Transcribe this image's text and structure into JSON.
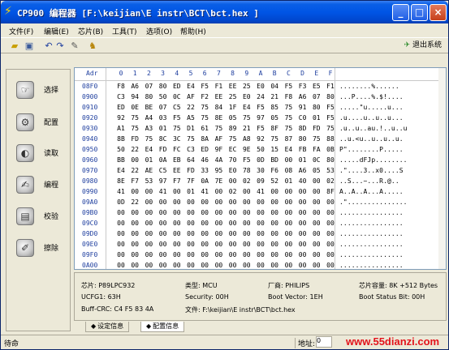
{
  "window": {
    "title": "CP900 编程器  [F:\\keijian\\E instr\\BCT\\bct.hex ]",
    "minimize": "_",
    "maximize": "□",
    "close": "×"
  },
  "menu": [
    "文件(F)",
    "编辑(E)",
    "芯片(B)",
    "工具(T)",
    "选项(O)",
    "帮助(H)"
  ],
  "toolbar": {
    "icons": [
      "open-folder-icon",
      "save-icon",
      "undo-icon",
      "redo-icon",
      "edit-icon",
      "find-icon"
    ],
    "exit_label": "退出系统"
  },
  "sidebar": [
    "选择",
    "配置",
    "读取",
    "编程",
    "校验",
    "擦除"
  ],
  "hex": {
    "addr_header": "Adr",
    "cols": [
      "0",
      "1",
      "2",
      "3",
      "4",
      "5",
      "6",
      "7",
      "8",
      "9",
      "A",
      "B",
      "C",
      "D",
      "E",
      "F"
    ],
    "rows": [
      {
        "addr": "08F0",
        "bytes": [
          "F8",
          "A6",
          "07",
          "80",
          "ED",
          "E4",
          "F5",
          "F1",
          "EE",
          "25",
          "E0",
          "04",
          "F5",
          "F3",
          "E5",
          "F1"
        ],
        "ascii": "........%......"
      },
      {
        "addr": "0900",
        "bytes": [
          "C3",
          "94",
          "80",
          "50",
          "0C",
          "AF",
          "F2",
          "EE",
          "25",
          "E0",
          "24",
          "21",
          "F8",
          "A6",
          "07",
          "80"
        ],
        "ascii": "...P....%.$!...."
      },
      {
        "addr": "0910",
        "bytes": [
          "ED",
          "0E",
          "BE",
          "07",
          "C5",
          "22",
          "75",
          "84",
          "1F",
          "E4",
          "F5",
          "85",
          "75",
          "91",
          "80",
          "F5"
        ],
        "ascii": ".....\"u.....u..."
      },
      {
        "addr": "0920",
        "bytes": [
          "92",
          "75",
          "A4",
          "03",
          "F5",
          "A5",
          "75",
          "8E",
          "05",
          "75",
          "97",
          "05",
          "75",
          "C0",
          "01",
          "F5"
        ],
        "ascii": ".u....u..u..u..."
      },
      {
        "addr": "0930",
        "bytes": [
          "A1",
          "75",
          "A3",
          "01",
          "75",
          "D1",
          "61",
          "75",
          "89",
          "21",
          "F5",
          "8F",
          "75",
          "8D",
          "FD",
          "75"
        ],
        "ascii": ".u..u..au.!..u..u"
      },
      {
        "addr": "0940",
        "bytes": [
          "8B",
          "FD",
          "75",
          "8C",
          "3C",
          "75",
          "8A",
          "AF",
          "75",
          "A8",
          "92",
          "75",
          "87",
          "80",
          "75",
          "88"
        ],
        "ascii": "..u.<u..u..u..u."
      },
      {
        "addr": "0950",
        "bytes": [
          "50",
          "22",
          "E4",
          "FD",
          "FC",
          "C3",
          "ED",
          "9F",
          "EC",
          "9E",
          "50",
          "15",
          "E4",
          "FB",
          "FA",
          "0B"
        ],
        "ascii": "P\"........P....."
      },
      {
        "addr": "0960",
        "bytes": [
          "BB",
          "00",
          "01",
          "0A",
          "EB",
          "64",
          "46",
          "4A",
          "70",
          "F5",
          "0D",
          "BD",
          "00",
          "01",
          "0C",
          "80"
        ],
        "ascii": ".....dFJp........"
      },
      {
        "addr": "0970",
        "bytes": [
          "E4",
          "22",
          "AE",
          "C5",
          "EE",
          "FD",
          "33",
          "95",
          "E0",
          "78",
          "30",
          "F6",
          "08",
          "A6",
          "05",
          "53"
        ],
        "ascii": ".\"....3..x0....S"
      },
      {
        "addr": "0980",
        "bytes": [
          "8E",
          "F7",
          "53",
          "97",
          "F7",
          "7F",
          "0A",
          "7E",
          "00",
          "02",
          "09",
          "52",
          "01",
          "40",
          "00",
          "02"
        ],
        "ascii": "..S...~...R.@.."
      },
      {
        "addr": "0990",
        "bytes": [
          "41",
          "00",
          "00",
          "41",
          "00",
          "01",
          "41",
          "00",
          "02",
          "00",
          "41",
          "00",
          "00",
          "00",
          "00",
          "8F"
        ],
        "ascii": "A..A..A...A....."
      },
      {
        "addr": "09A0",
        "bytes": [
          "0D",
          "22",
          "00",
          "00",
          "00",
          "00",
          "00",
          "00",
          "00",
          "00",
          "00",
          "00",
          "00",
          "00",
          "00",
          "00"
        ],
        "ascii": ".\"..............."
      },
      {
        "addr": "09B0",
        "bytes": [
          "00",
          "00",
          "00",
          "00",
          "00",
          "00",
          "00",
          "00",
          "00",
          "00",
          "00",
          "00",
          "00",
          "00",
          "00",
          "00"
        ],
        "ascii": "................"
      },
      {
        "addr": "09C0",
        "bytes": [
          "00",
          "00",
          "00",
          "00",
          "00",
          "00",
          "00",
          "00",
          "00",
          "00",
          "00",
          "00",
          "00",
          "00",
          "00",
          "00"
        ],
        "ascii": "................"
      },
      {
        "addr": "09D0",
        "bytes": [
          "00",
          "00",
          "00",
          "00",
          "00",
          "00",
          "00",
          "00",
          "00",
          "00",
          "00",
          "00",
          "00",
          "00",
          "00",
          "00"
        ],
        "ascii": "................"
      },
      {
        "addr": "09E0",
        "bytes": [
          "00",
          "00",
          "00",
          "00",
          "00",
          "00",
          "00",
          "00",
          "00",
          "00",
          "00",
          "00",
          "00",
          "00",
          "00",
          "00"
        ],
        "ascii": "................"
      },
      {
        "addr": "09F0",
        "bytes": [
          "00",
          "00",
          "00",
          "00",
          "00",
          "00",
          "00",
          "00",
          "00",
          "00",
          "00",
          "00",
          "00",
          "00",
          "00",
          "00"
        ],
        "ascii": "................"
      },
      {
        "addr": "0A00",
        "bytes": [
          "00",
          "00",
          "00",
          "00",
          "00",
          "00",
          "00",
          "00",
          "00",
          "00",
          "00",
          "00",
          "00",
          "00",
          "00",
          "00"
        ],
        "ascii": "................"
      }
    ]
  },
  "info": {
    "chip": "芯片: P89LPC932",
    "type": "类型: MCU",
    "maker": "厂商: PHILIPS",
    "capacity": "芯片容量: 8K +512 Bytes",
    "ucfg": "UCFG1: 63H",
    "security": "Security: 00H",
    "boot_vector": "Boot Vector: 1EH",
    "boot_status": "Boot Status Bit: 00H",
    "buff_crc": "Buff-CRC: C4 F5 83 4A",
    "file": "文件: F:\\keijian\\E instr\\BCT\\bct.hex"
  },
  "tabs": [
    "设定信息",
    "配置信息"
  ],
  "status": {
    "ready": "待命",
    "addr_label": "地址:",
    "addr_value": "0"
  },
  "watermark": "www.55dianzi.com"
}
